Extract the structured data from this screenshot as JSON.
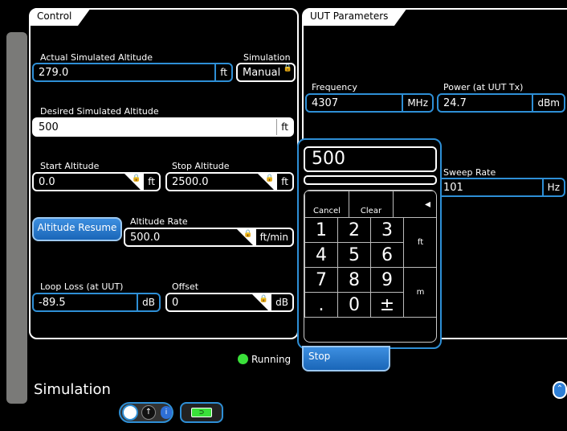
{
  "control": {
    "title": "Control",
    "actual_alt_label": "Actual Simulated Altitude",
    "actual_alt_value": "279.0",
    "actual_alt_unit": "ft",
    "simulation_label": "Simulation",
    "simulation_value": "Manual",
    "desired_alt_label": "Desired Simulated Altitude",
    "desired_alt_value": "500",
    "desired_alt_unit": "ft",
    "start_alt_label": "Start Altitude",
    "start_alt_value": "0.0",
    "start_alt_unit": "ft",
    "stop_alt_label": "Stop Altitude",
    "stop_alt_value": "2500.0",
    "stop_alt_unit": "ft",
    "altitude_resume_label": "Altitude Resume",
    "alt_rate_label": "Altitude Rate",
    "alt_rate_value": "500.0",
    "alt_rate_unit": "ft/min",
    "loop_loss_label": "Loop Loss (at UUT)",
    "loop_loss_value": "-89.5",
    "loop_loss_unit": "dB",
    "offset_label": "Offset",
    "offset_value": "0",
    "offset_unit": "dB"
  },
  "uut": {
    "title": "UUT Parameters",
    "frequency_label": "Frequency",
    "frequency_value": "4307",
    "frequency_unit": "MHz",
    "power_label": "Power (at UUT Tx)",
    "power_value": "24.7",
    "power_unit": "dBm",
    "sweep_rate_label": "Sweep Rate",
    "sweep_rate_value": "101",
    "sweep_rate_unit": "Hz"
  },
  "keypad": {
    "display": "500",
    "cancel": "Cancel",
    "clear": "Clear",
    "backspace": "◂",
    "keys": [
      "1",
      "2",
      "3",
      "4",
      "5",
      "6",
      "7",
      "8",
      "9",
      ".",
      "0",
      "±"
    ],
    "unit_ft": "ft",
    "unit_m": "m"
  },
  "status": {
    "running_label": "Running",
    "stop_label": "Stop"
  },
  "footer": {
    "title": "Simulation",
    "toggle_mid": "↑",
    "toggle_info": "i",
    "battery_glyph": "⊃",
    "scroll_up": "⌃"
  },
  "colors": {
    "accent": "#2e8fd6",
    "running": "#3ae03a"
  }
}
